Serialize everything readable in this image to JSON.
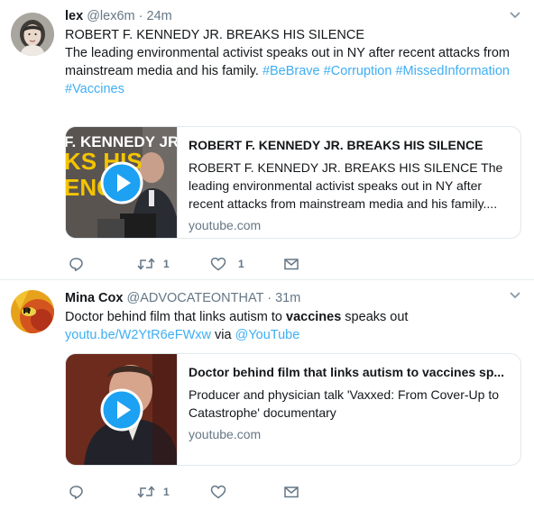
{
  "tweets": [
    {
      "name": "lex",
      "handle": "@lex6m",
      "time": "24m",
      "text_lines": [
        "ROBERT F. KENNEDY JR. BREAKS HIS SILENCE",
        "The leading environmental activist speaks out in NY after recent attacks from",
        "mainstream media and his family."
      ],
      "hashtags": [
        "#BeBrave",
        "#Corruption",
        "#MissedInformation",
        "#Vaccines"
      ],
      "card": {
        "thumb_text": [
          "F. KENNEDY JR.",
          "KS HIS",
          "ENCE"
        ],
        "title": "ROBERT F. KENNEDY JR. BREAKS HIS SILENCE",
        "desc": "ROBERT F. KENNEDY JR. BREAKS HIS SILENCE The leading environmental activist speaks out in NY after recent attacks from mainstream media and his family....",
        "domain": "youtube.com"
      },
      "actions": {
        "reply": "",
        "retweet": "1",
        "like": "1"
      }
    },
    {
      "name": "Mina Cox",
      "handle": "@ADVOCATEONTHAT",
      "time": "31m",
      "text_before": "Doctor behind film that links autism to ",
      "text_bold": "vaccines",
      "text_after": " speaks out",
      "link": "youtu.be/W2YtR6eFWxw",
      "via": "via",
      "mention": "@YouTube",
      "card": {
        "title": "Doctor behind film that links autism to vaccines sp...",
        "desc": "Producer and physician talk 'Vaxxed: From Cover-Up to Catastrophe' documentary",
        "domain": "youtube.com"
      },
      "actions": {
        "reply": "",
        "retweet": "1",
        "like": ""
      }
    }
  ],
  "icons": {
    "reply": "reply-icon",
    "retweet": "retweet-icon",
    "like": "heart-icon",
    "message": "envelope-icon",
    "caret": "chevron-down-icon",
    "play": "play-button-icon"
  },
  "colors": {
    "link": "#1da1f2",
    "secondary": "#657786",
    "border": "#e1e8ed",
    "play": "#1da1f2"
  }
}
